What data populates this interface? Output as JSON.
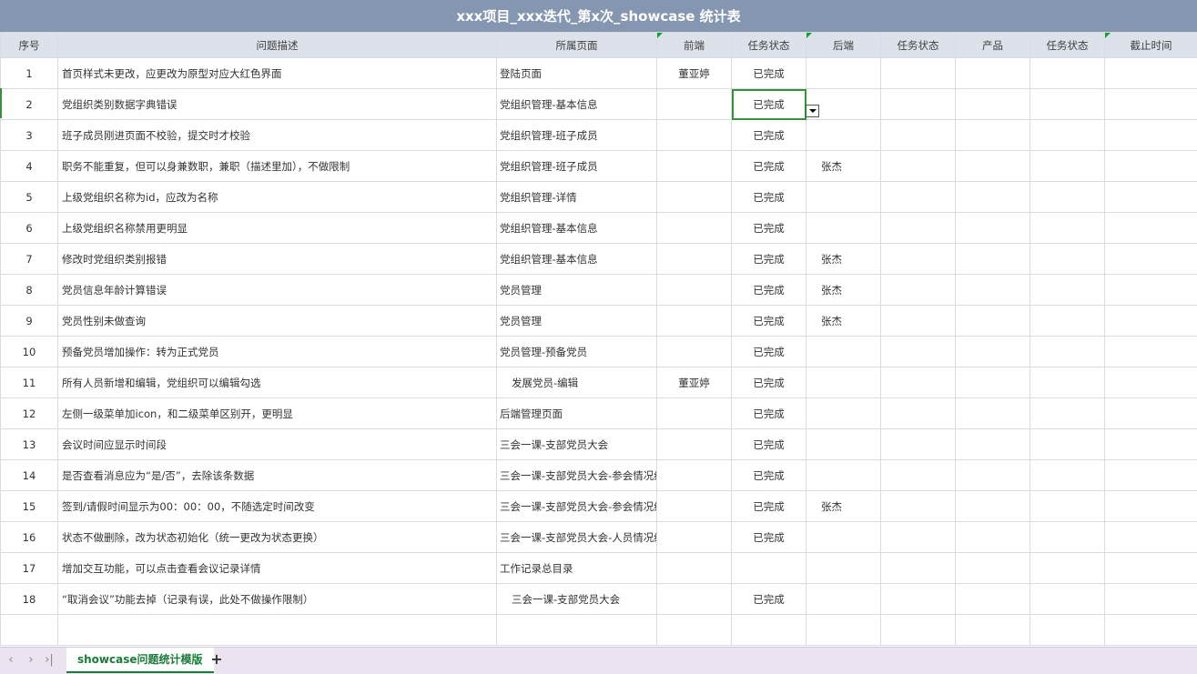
{
  "title": "xxx项目_xxx迭代_第x次_showcase 统计表",
  "headers": [
    "序号",
    "问题描述",
    "所属页面",
    "前端",
    "任务状态",
    "后端",
    "任务状态",
    "产品",
    "任务状态",
    "截止时间"
  ],
  "rows": [
    {
      "idx": "1",
      "desc": "首页样式未更改，应更改为原型对应大红色界面",
      "page": "登陆页面",
      "fe": "董亚婷",
      "status": "已完成",
      "be": ""
    },
    {
      "idx": "2",
      "desc": "党组织类别数据字典错误",
      "page": "党组织管理-基本信息",
      "fe": "",
      "status": "已完成",
      "be": ""
    },
    {
      "idx": "3",
      "desc": "班子成员刚进页面不校验，提交时才校验",
      "page": "党组织管理-班子成员",
      "fe": "",
      "status": "已完成",
      "be": ""
    },
    {
      "idx": "4",
      "desc": "职务不能重复，但可以身兼数职，兼职（描述里加），不做限制",
      "page": "党组织管理-班子成员",
      "fe": "",
      "status": "已完成",
      "be": "张杰"
    },
    {
      "idx": "5",
      "desc": "上级党组织名称为id，应改为名称",
      "page": "党组织管理-详情",
      "fe": "",
      "status": "已完成",
      "be": ""
    },
    {
      "idx": "6",
      "desc": "上级党组织名称禁用更明显",
      "page": "党组织管理-基本信息",
      "fe": "",
      "status": "已完成",
      "be": ""
    },
    {
      "idx": "7",
      "desc": "修改时党组织类别报错",
      "page": "党组织管理-基本信息",
      "fe": "",
      "status": "已完成",
      "be": "张杰"
    },
    {
      "idx": "8",
      "desc": "党员信息年龄计算错误",
      "page": "党员管理",
      "fe": "",
      "status": "已完成",
      "be": "张杰"
    },
    {
      "idx": "9",
      "desc": "党员性别未做查询",
      "page": "党员管理",
      "fe": "",
      "status": "已完成",
      "be": "张杰"
    },
    {
      "idx": "10",
      "desc": "预备党员增加操作：转为正式党员",
      "page": "党员管理-预备党员",
      "fe": "",
      "status": "已完成",
      "be": ""
    },
    {
      "idx": "11",
      "desc": "所有人员新增和编辑，党组织可以编辑勾选",
      "page": "发展党员-编辑",
      "fe": "董亚婷",
      "status": "已完成",
      "be": ""
    },
    {
      "idx": "12",
      "desc": "左侧一级菜单加icon，和二级菜单区别开，更明显",
      "page": "后端管理页面",
      "fe": "",
      "status": "已完成",
      "be": ""
    },
    {
      "idx": "13",
      "desc": "会议时间应显示时间段",
      "page": "三会一课-支部党员大会",
      "fe": "",
      "status": "已完成",
      "be": ""
    },
    {
      "idx": "14",
      "desc": "是否查看消息应为“是/否”，去除该条数据",
      "page": "三会一课-支部党员大会-参会情况统计",
      "fe": "",
      "status": "已完成",
      "be": ""
    },
    {
      "idx": "15",
      "desc": "签到/请假时间显示为00：00：00，不随选定时间改变",
      "page": "三会一课-支部党员大会-参会情况统计",
      "fe": "",
      "status": "已完成",
      "be": "张杰"
    },
    {
      "idx": "16",
      "desc": "状态不做删除，改为状态初始化（统一更改为状态更换）",
      "page": "三会一课-支部党员大会-人员情况统计",
      "fe": "",
      "status": "已完成",
      "be": ""
    },
    {
      "idx": "17",
      "desc": "增加交互功能，可以点击查看会议记录详情",
      "page": "工作记录总目录",
      "fe": "",
      "status": "",
      "be": ""
    },
    {
      "idx": "18",
      "desc": "“取消会议”功能去掉（记录有误，此处不做操作限制）",
      "page": "三会一课-支部党员大会",
      "fe": "",
      "status": "已完成",
      "be": ""
    }
  ],
  "sheet_tab": "showcase问题统计模版",
  "add_sheet": "+",
  "nav": {
    "prev": "‹",
    "next": "›",
    "last": "›|"
  }
}
